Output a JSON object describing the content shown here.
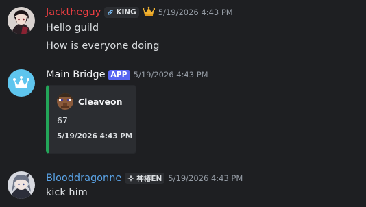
{
  "messages": [
    {
      "author": "Jacktheguy",
      "author_color": "#f23f43",
      "tag": {
        "icon": "feather-icon",
        "label": "KING"
      },
      "decoration": "crown-icon",
      "timestamp": "5/19/2026 4:43 PM",
      "lines": [
        "Hello guild",
        "How is everyone doing"
      ]
    },
    {
      "author": "Main Bridge",
      "author_color": "#f2f3f5",
      "badge": "APP",
      "timestamp": "5/19/2026 4:43 PM",
      "embed": {
        "accent_color": "#23a559",
        "author_name": "Cleaveon",
        "author_icon": "minecraft-head-icon",
        "description": "67",
        "footer": "5/19/2026 4:43 PM"
      }
    },
    {
      "author": "Blooddragonne",
      "author_color": "#5aa3e6",
      "tag": {
        "icon": "diamond-icon",
        "label": "神椿EN"
      },
      "timestamp": "5/19/2026 4:43 PM",
      "lines": [
        "kick him"
      ]
    }
  ]
}
